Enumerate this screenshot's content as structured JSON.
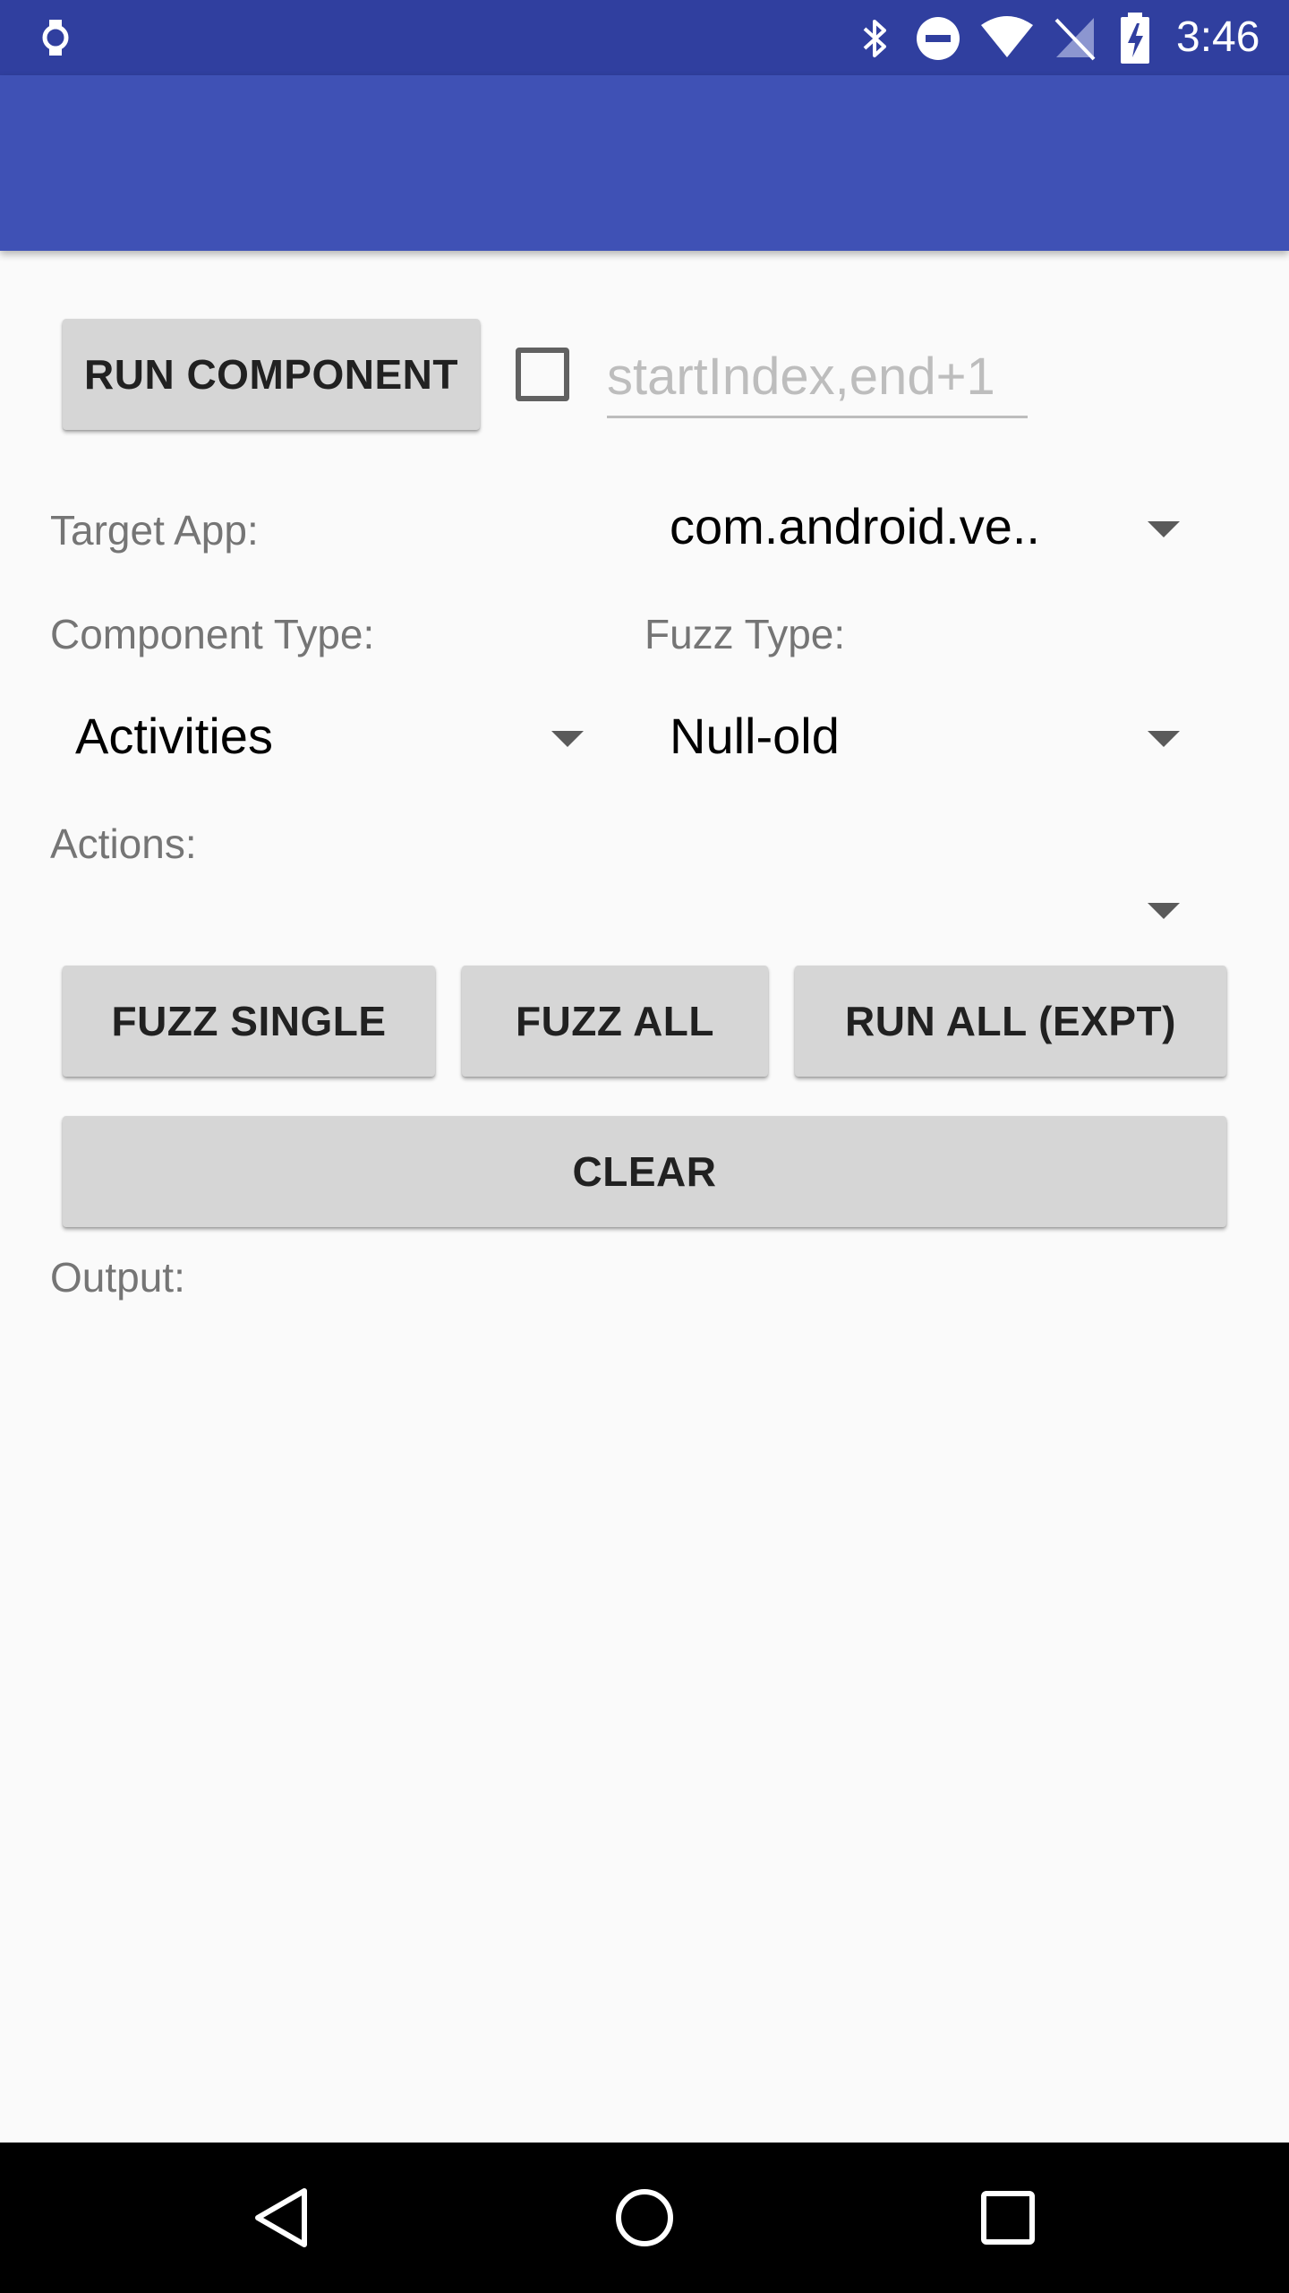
{
  "status_bar": {
    "time": "3:46",
    "icons": [
      "watch-icon",
      "bluetooth-icon",
      "do-not-disturb-icon",
      "wifi-icon",
      "no-signal-icon",
      "battery-charging-icon"
    ]
  },
  "main": {
    "run_component_label": "RUN COMPONENT",
    "range_input": {
      "placeholder": "startIndex,end+1",
      "value": ""
    },
    "range_checkbox_checked": false,
    "target_app_label": "Target App:",
    "target_app_value": "com.android.ve..",
    "component_type_label": "Component Type:",
    "component_type_value": "Activities",
    "fuzz_type_label": "Fuzz Type:",
    "fuzz_type_value": "Null-old",
    "actions_label": "Actions:",
    "actions_value": "",
    "fuzz_single_label": "FUZZ SINGLE",
    "fuzz_all_label": "FUZZ ALL",
    "run_all_label": "RUN ALL (EXPT)",
    "clear_label": "CLEAR",
    "output_label": "Output:",
    "output_text": ""
  },
  "colors": {
    "status_bar": "#303f9f",
    "app_bar": "#3f51b5",
    "background": "#fafafa",
    "button": "#d6d6d6",
    "nav_bar": "#000000"
  },
  "nav_bar": {
    "icons": [
      "back-icon",
      "home-icon",
      "recents-icon"
    ]
  }
}
